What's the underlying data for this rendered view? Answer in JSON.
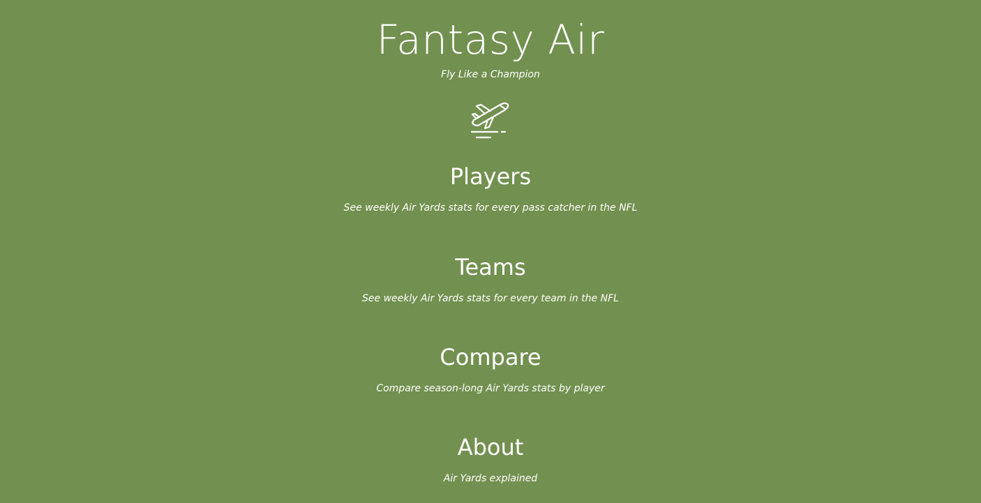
{
  "header": {
    "title": "Fantasy Air",
    "tagline": "Fly Like a Champion",
    "logo_icon": "airplane-takeoff-icon"
  },
  "nav": {
    "players": {
      "title": "Players",
      "description": "See weekly Air Yards stats for every pass catcher in the NFL"
    },
    "teams": {
      "title": "Teams",
      "description": "See weekly Air Yards stats for every team in the NFL"
    },
    "compare": {
      "title": "Compare",
      "description": "Compare season-long Air Yards stats by player"
    },
    "about": {
      "title": "About",
      "description": "Air Yards explained"
    }
  },
  "colors": {
    "background": "#72904f",
    "text": "#ffffff"
  }
}
